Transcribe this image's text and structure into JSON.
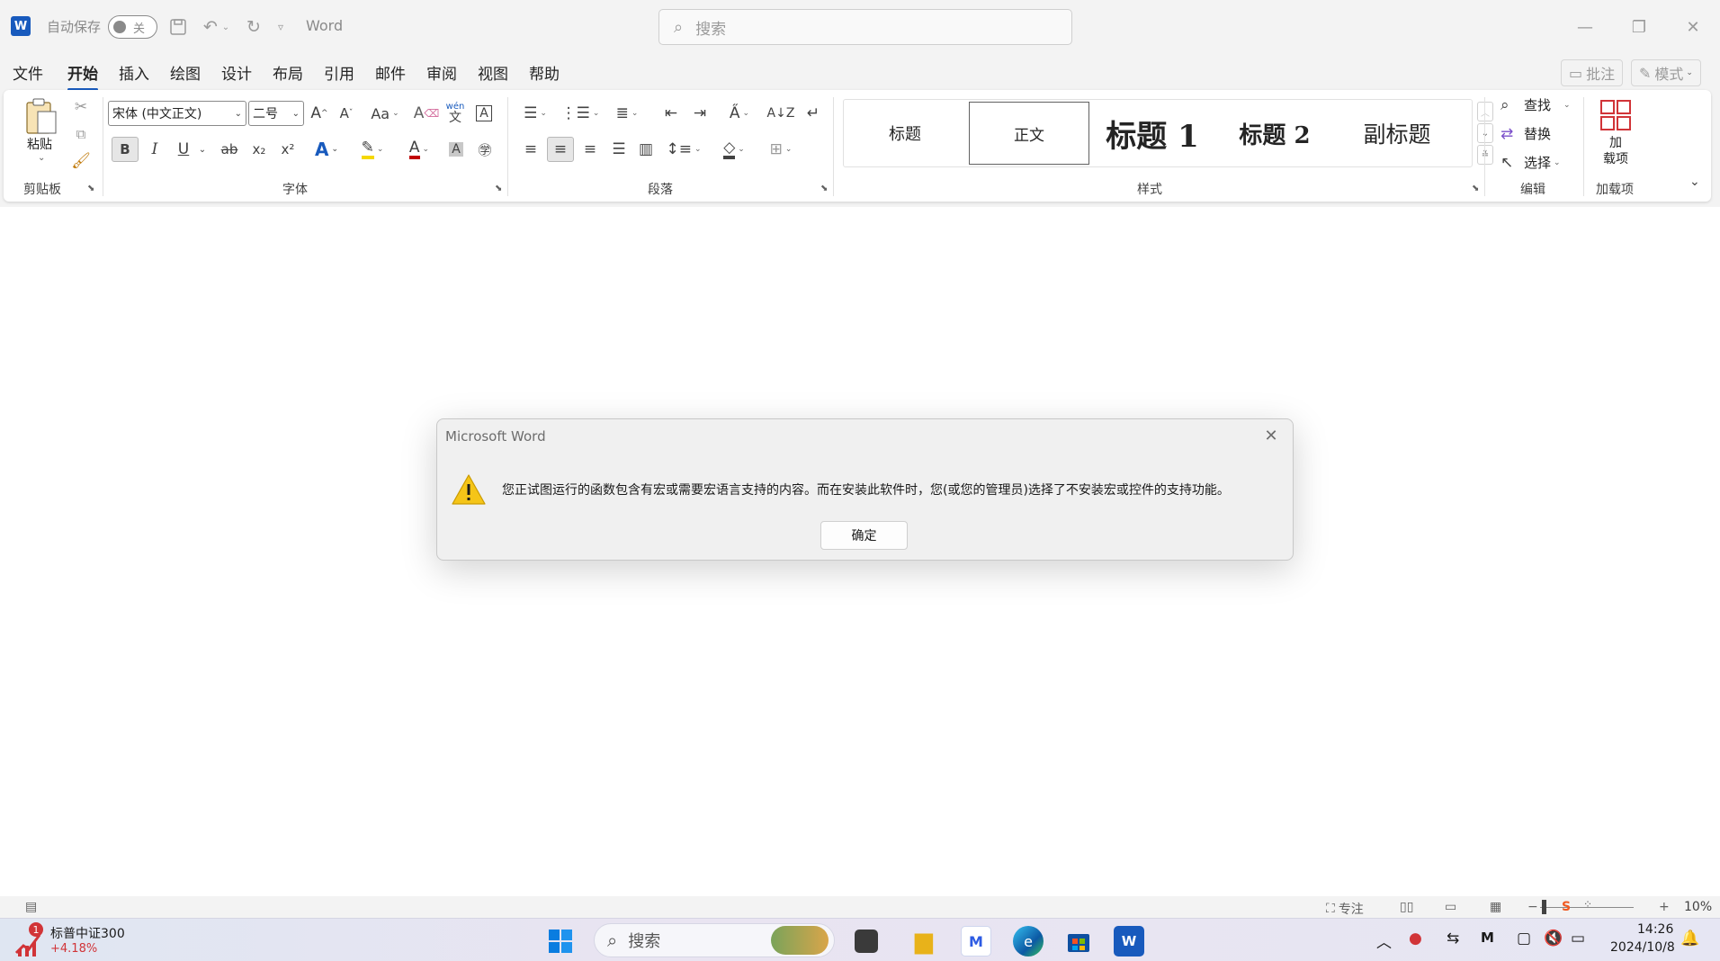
{
  "titlebar": {
    "autosave_label": "自动保存",
    "autosave_state": "关",
    "app_name": "Word",
    "search_placeholder": "搜索",
    "minimize": "—",
    "restore": "❐",
    "close": "✕"
  },
  "tabs": [
    "文件",
    "开始",
    "插入",
    "绘图",
    "设计",
    "布局",
    "引用",
    "邮件",
    "审阅",
    "视图",
    "帮助"
  ],
  "active_tab": "开始",
  "tab_actions": {
    "comment": "批注",
    "mode": "模式"
  },
  "ribbon": {
    "clipboard": {
      "label": "剪贴板",
      "paste": "粘贴"
    },
    "font": {
      "label": "字体",
      "font_name": "宋体 (中文正文)",
      "font_size": "二号",
      "case": "Aa",
      "wen": "wén",
      "bold": "B",
      "italic": "I",
      "underline": "U",
      "strike": "ab",
      "sub": "x₂",
      "sup": "x²"
    },
    "paragraph": {
      "label": "段落"
    },
    "styles": {
      "label": "样式",
      "items": [
        "标题",
        "正文",
        "标题 1",
        "标题 2",
        "副标题"
      ]
    },
    "editing": {
      "label": "编辑",
      "find": "查找",
      "replace": "替换",
      "select": "选择"
    },
    "addins": {
      "label": "加载项",
      "button": "加\n载项"
    }
  },
  "dialog": {
    "title": "Microsoft Word",
    "message": "您正试图运行的函数包含有宏或需要宏语言支持的内容。而在安装此软件时，您(或您的管理员)选择了不安装宏或控件的支持功能。",
    "ok": "确定"
  },
  "statusbar": {
    "focus": "专注",
    "zoom_minus": "−",
    "zoom_plus": "+",
    "zoom": "10%"
  },
  "taskbar": {
    "stock_name": "标普中证300",
    "stock_change": "+4.18%",
    "stock_badge": "1",
    "search": "搜索",
    "time": "14:26",
    "date": "2024/10/8"
  },
  "colors": {
    "accent": "#185abd",
    "warning": "#f5c518"
  }
}
